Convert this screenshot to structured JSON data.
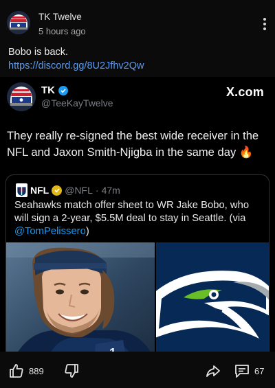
{
  "post": {
    "author": "TK Twelve",
    "time": "5 hours ago",
    "text": "Bobo is back.",
    "link": "https://discord.gg/8U2Jfhv2Qw"
  },
  "embed": {
    "name": "TK",
    "handle": "@TeeKayTwelve",
    "source": "X.com",
    "text": "They really re-signed the best wide receiver in the NFL and Jaxon Smith-Njigba in the same day 🔥",
    "quote": {
      "name": "NFL",
      "handle": "@NFL",
      "separator": "·",
      "age": "47m",
      "text": "Seahawks match offer sheet to WR Jake Bobo, who will sign a 2-year, $5.5M deal to stay in Seattle. (via",
      "mention": "@TomPelissero",
      "close": ")",
      "jersey_number": "1"
    }
  },
  "actions": {
    "upvotes": "889",
    "comments": "67"
  },
  "colors": {
    "link": "#5b9bf0",
    "verified": "#1d9bf0",
    "gold_badge": "#e2b719",
    "seahawks_navy": "#062a55",
    "seahawks_green": "#69be28"
  }
}
